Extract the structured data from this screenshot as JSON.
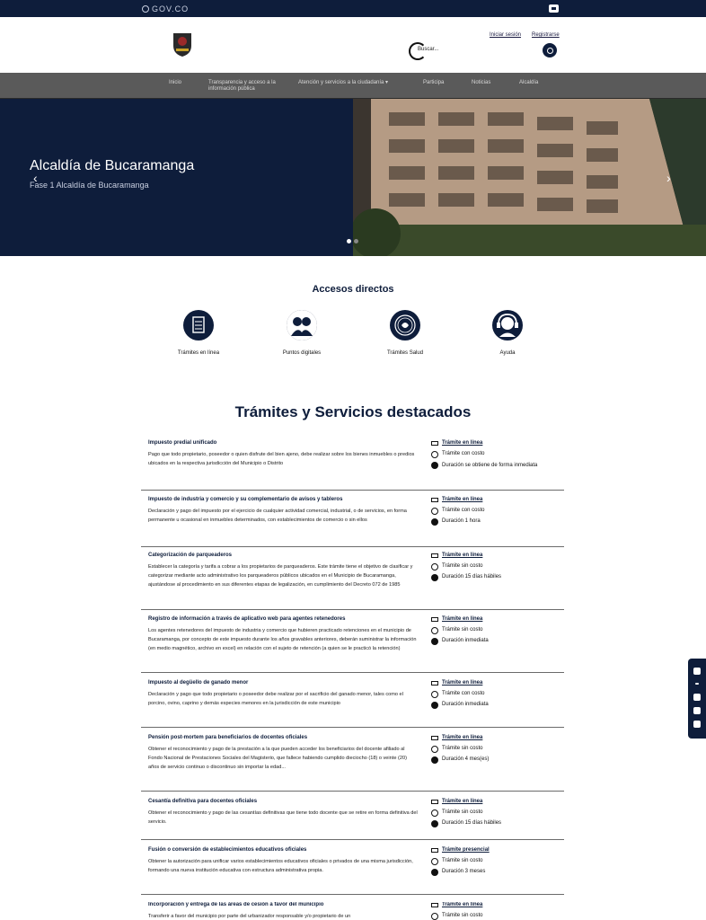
{
  "gov": {
    "logo": "GOV.CO"
  },
  "header": {
    "login": "Iniciar sesión",
    "register": "Registrarse",
    "search_placeholder": "Buscar..."
  },
  "nav": [
    {
      "label": "Inicio"
    },
    {
      "label": "Transparencia y acceso a la información pública"
    },
    {
      "label": "Atención y servicios a la ciudadanía ▾"
    },
    {
      "label": "Participa"
    },
    {
      "label": "Noticias"
    },
    {
      "label": "Alcaldía"
    }
  ],
  "hero": {
    "title": "Alcaldía de Bucaramanga",
    "subtitle": "Fase 1 Alcaldía de Bucaramanga",
    "prev": "‹",
    "next": "›"
  },
  "accesos": {
    "title": "Accesos directos",
    "items": [
      {
        "label": "Trámites en línea",
        "icon": "document-icon"
      },
      {
        "label": "Puntos digitales",
        "icon": "people-icon"
      },
      {
        "label": "Trámites Salud",
        "icon": "health-icon"
      },
      {
        "label": "Ayuda",
        "icon": "headset-icon"
      }
    ]
  },
  "tramites": {
    "title": "Trámites y Servicios destacados",
    "items": [
      {
        "title": "Impuesto predial unificado",
        "desc": "Pago que todo propietario, poseedor o quien disfrute del bien ajeno, debe realizar sobre los bienes inmuebles o predios ubicados en la respectiva jurisdicción del Municipio o Distrito",
        "mode": "Trámite en línea",
        "cost": "Trámite con costo",
        "duration": "Duración se obtiene de forma inmediata"
      },
      {
        "title": "Impuesto de industria y comercio y su complementario de avisos y tableros",
        "desc": "Declaración y pago del impuesto por el ejercicio de cualquier actividad comercial, industrial, o de servicios, en forma permanente u ocasional en inmuebles determinados, con establecimientos de comercio o sin ellos",
        "mode": "Trámite en línea",
        "cost": "Trámite con costo",
        "duration": "Duración 1 hora"
      },
      {
        "title": "Categorización de parqueaderos",
        "desc": "Establecer la categoría y tarifa a cobrar a los propietarios de parqueaderos. Este trámite tiene el objetivo de clasificar y categorizar mediante acto administrativo los parqueaderos públicos ubicados en el Municipio de Bucaramanga, ajustándose al procedimiento en sus diferentes etapas de legalización, en cumplimiento del Decreto 072 de 1985",
        "mode": "Trámite en línea",
        "cost": "Trámite sin costo",
        "duration": "Duración 15 días hábiles"
      },
      {
        "title": "Registro de información a través de aplicativo web para agentes retenedores",
        "desc": "Los agentes retenedores del impuesto de industria y comercio que hubieren practicado retenciones en el municipio de Bucaramanga, por concepto de este impuesto durante los años gravables anteriores, deberán suministrar la información (en medio magnético, archivo en excel) en relación con el sujeto de retención (a quien se le practicó la retención)",
        "mode": "Trámite en línea",
        "cost": "Trámite sin costo",
        "duration": "Duración inmediata"
      },
      {
        "title": "Impuesto al degüello de ganado menor",
        "desc": "Declaración y pago que todo propietario o poseedor debe realizar por el sacrificio del ganado menor, tales como el porcino, ovino, caprino y demás especies menores en la jurisdicción de este municipio",
        "mode": "Trámite en línea",
        "cost": "Trámite con costo",
        "duration": "Duración inmediata"
      },
      {
        "title": "Pensión post-mortem para beneficiarios de docentes oficiales",
        "desc": "Obtener el reconocimiento y pago de la prestación a la que pueden acceder los beneficiarios del docente afiliado al Fondo Nacional de Prestaciones Sociales del Magisterio, que fallece habiendo cumplido dieciocho (18) o veinte (20) años de servicio continuo o discontinuo sin importar la edad...",
        "mode": "Trámite en línea",
        "cost": "Trámite sin costo",
        "duration": "Duración 4 mes(es)"
      },
      {
        "title": "Cesantía definitiva para docentes oficiales",
        "desc": "Obtener el reconocimiento y pago de las cesantías definitivas que tiene todo docente que se retire en forma definitiva del servicio.",
        "mode": "Trámite en línea",
        "cost": "Trámite sin costo",
        "duration": "Duración 15 días hábiles"
      },
      {
        "title": "Fusión o conversión de establecimientos educativos oficiales",
        "desc": "Obtener la autorización para unificar varios establecimientos educativos oficiales o privados de una misma jurisdicción, formando una nueva institución educativa con estructura administrativa propia.",
        "mode": "Trámite presencial",
        "cost": "Trámite sin costo",
        "duration": "Duración 3 meses"
      },
      {
        "title": "Incorporación y entrega de las áreas de cesión a favor del municipio",
        "desc": "Transferir a favor del municipio por parte del urbanizador responsable y/o propietario de un",
        "mode": "Trámite en línea",
        "cost": "Trámite sin costo",
        "duration": ""
      }
    ]
  }
}
